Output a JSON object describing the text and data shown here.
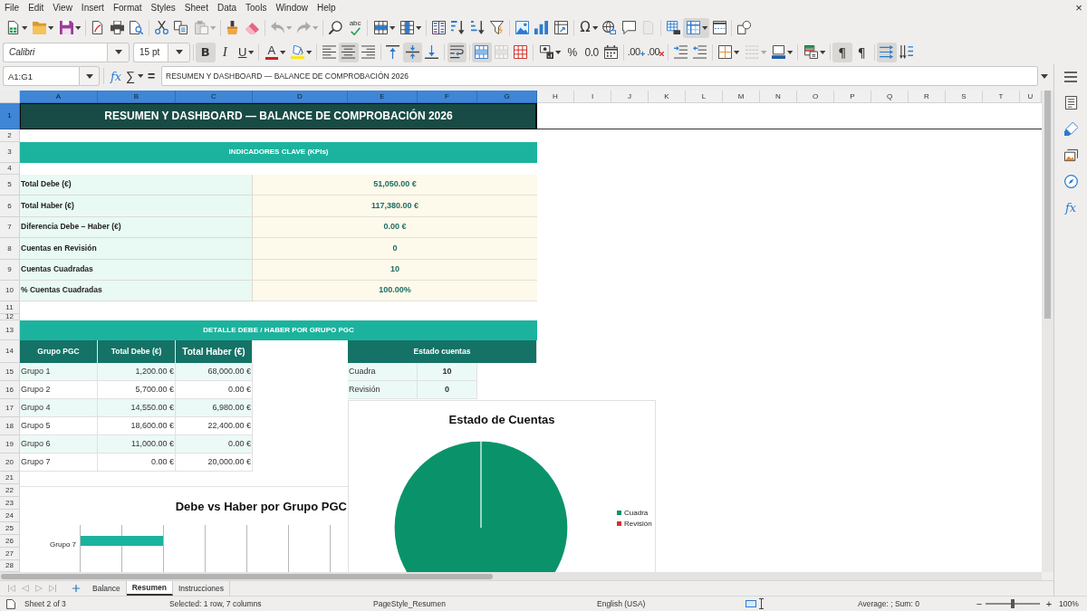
{
  "menu_bar": {
    "items": [
      "File",
      "Edit",
      "View",
      "Insert",
      "Format",
      "Styles",
      "Sheet",
      "Data",
      "Tools",
      "Window",
      "Help"
    ],
    "close": "×"
  },
  "standard_toolbar": {
    "groups": [
      [
        {
          "kind": "new",
          "pressed": false,
          "disabled": false,
          "dropdown": true
        },
        {
          "kind": "open",
          "pressed": false,
          "disabled": false,
          "dropdown": true
        },
        {
          "kind": "save",
          "pressed": false,
          "disabled": false,
          "dropdown": true
        }
      ],
      [
        {
          "kind": "export-pdf",
          "pressed": false,
          "disabled": false,
          "dropdown": false
        },
        {
          "kind": "print",
          "pressed": false,
          "disabled": false,
          "dropdown": false
        },
        {
          "kind": "print-preview",
          "pressed": false,
          "disabled": false,
          "dropdown": false
        }
      ],
      [
        {
          "kind": "cut",
          "pressed": false,
          "disabled": false,
          "dropdown": false
        },
        {
          "kind": "copy",
          "pressed": false,
          "disabled": false,
          "dropdown": false
        },
        {
          "kind": "paste",
          "pressed": false,
          "disabled": true,
          "dropdown": true
        }
      ],
      [
        {
          "kind": "clone-formatting",
          "pressed": false,
          "disabled": false,
          "dropdown": false
        },
        {
          "kind": "clear-formatting",
          "pressed": false,
          "disabled": false,
          "dropdown": false
        }
      ],
      [
        {
          "kind": "undo",
          "pressed": false,
          "disabled": true,
          "dropdown": true
        },
        {
          "kind": "redo",
          "pressed": false,
          "disabled": true,
          "dropdown": true
        }
      ],
      [
        {
          "kind": "find-replace",
          "pressed": false,
          "disabled": false,
          "dropdown": false
        },
        {
          "kind": "spelling",
          "label": "abc",
          "pressed": false,
          "disabled": false,
          "dropdown": false
        }
      ],
      [
        {
          "kind": "insert-rows",
          "pressed": false,
          "disabled": false,
          "dropdown": true
        },
        {
          "kind": "insert-columns",
          "pressed": false,
          "disabled": false,
          "dropdown": true
        }
      ],
      [
        {
          "kind": "sort",
          "pressed": false,
          "disabled": false,
          "dropdown": false
        },
        {
          "kind": "sort-ascending",
          "pressed": false,
          "disabled": false,
          "dropdown": false
        },
        {
          "kind": "sort-descending",
          "pressed": false,
          "disabled": false,
          "dropdown": false
        },
        {
          "kind": "autofilter",
          "pressed": false,
          "disabled": false,
          "dropdown": false
        }
      ],
      [
        {
          "kind": "insert-image",
          "pressed": false,
          "disabled": false,
          "dropdown": false
        },
        {
          "kind": "insert-chart",
          "pressed": false,
          "disabled": false,
          "dropdown": false
        },
        {
          "kind": "pivot-table",
          "pressed": false,
          "disabled": false,
          "dropdown": false
        }
      ],
      [
        {
          "kind": "special-character",
          "label": "Ω",
          "pressed": false,
          "disabled": false,
          "dropdown": true
        },
        {
          "kind": "hyperlink",
          "pressed": false,
          "disabled": false,
          "dropdown": false
        },
        {
          "kind": "comment",
          "pressed": false,
          "disabled": false,
          "dropdown": false
        },
        {
          "kind": "header-footer",
          "pressed": false,
          "disabled": true,
          "dropdown": false
        }
      ],
      [
        {
          "kind": "print-area",
          "pressed": false,
          "disabled": false,
          "dropdown": false
        },
        {
          "kind": "freeze",
          "pressed": true,
          "disabled": false,
          "dropdown": true
        },
        {
          "kind": "split-window",
          "pressed": false,
          "disabled": false,
          "dropdown": false
        }
      ],
      [
        {
          "kind": "draw-functions",
          "pressed": false,
          "disabled": false,
          "dropdown": false
        }
      ]
    ]
  },
  "formatting_toolbar": {
    "font_name": "Calibri",
    "font_size": "15 pt",
    "groups": [
      [
        {
          "kind": "bold",
          "label": "B",
          "pressed": true,
          "disabled": false,
          "dropdown": false
        },
        {
          "kind": "italic",
          "label": "I",
          "pressed": false,
          "disabled": false,
          "dropdown": false
        },
        {
          "kind": "underline",
          "label": "U",
          "pressed": false,
          "disabled": false,
          "dropdown": true
        }
      ],
      [
        {
          "kind": "font-color",
          "label": "A",
          "pressed": false,
          "disabled": false,
          "dropdown": true
        },
        {
          "kind": "highlight",
          "pressed": false,
          "disabled": false,
          "dropdown": true
        }
      ],
      [
        {
          "kind": "align-left",
          "pressed": false,
          "disabled": false,
          "dropdown": false
        },
        {
          "kind": "align-center",
          "pressed": true,
          "disabled": false,
          "dropdown": false
        },
        {
          "kind": "align-right",
          "pressed": false,
          "disabled": false,
          "dropdown": false
        }
      ],
      [
        {
          "kind": "align-top",
          "pressed": false,
          "disabled": false,
          "dropdown": false
        },
        {
          "kind": "align-middle",
          "pressed": true,
          "disabled": false,
          "dropdown": false
        },
        {
          "kind": "align-bottom",
          "pressed": false,
          "disabled": false,
          "dropdown": false
        }
      ],
      [
        {
          "kind": "wrap-text",
          "pressed": true,
          "disabled": false,
          "dropdown": false
        }
      ],
      [
        {
          "kind": "merge-center",
          "pressed": true,
          "disabled": false,
          "dropdown": false
        },
        {
          "kind": "merge-cells",
          "pressed": false,
          "disabled": true,
          "dropdown": false
        },
        {
          "kind": "unmerge-cells",
          "pressed": false,
          "disabled": false,
          "dropdown": false
        }
      ],
      [
        {
          "kind": "currency",
          "pressed": false,
          "disabled": false,
          "dropdown": true
        },
        {
          "kind": "percent",
          "label": "%",
          "pressed": false,
          "disabled": false,
          "dropdown": false
        },
        {
          "kind": "number",
          "label": "0.0",
          "pressed": false,
          "disabled": false,
          "dropdown": false
        },
        {
          "kind": "date",
          "pressed": false,
          "disabled": false,
          "dropdown": false
        }
      ],
      [
        {
          "kind": "add-decimal",
          "label": ".00",
          "pressed": false,
          "disabled": false,
          "dropdown": false
        },
        {
          "kind": "delete-decimal",
          "label": ".00",
          "pressed": false,
          "disabled": false,
          "dropdown": false
        }
      ],
      [
        {
          "kind": "indent-increase",
          "pressed": false,
          "disabled": false,
          "dropdown": false
        },
        {
          "kind": "indent-decrease",
          "pressed": false,
          "disabled": false,
          "dropdown": false
        }
      ],
      [
        {
          "kind": "borders",
          "pressed": false,
          "disabled": false,
          "dropdown": true
        },
        {
          "kind": "border-style",
          "pressed": false,
          "disabled": true,
          "dropdown": true
        },
        {
          "kind": "border-color",
          "pressed": false,
          "disabled": false,
          "dropdown": true
        }
      ],
      [
        {
          "kind": "conditional",
          "pressed": false,
          "disabled": false,
          "dropdown": true
        }
      ],
      [
        {
          "kind": "paragraph-ltr",
          "label": "¶",
          "pressed": true,
          "disabled": false,
          "dropdown": false
        },
        {
          "kind": "paragraph-rtl",
          "label": "¶",
          "pressed": false,
          "disabled": false,
          "dropdown": false
        }
      ],
      [
        {
          "kind": "text-ltr",
          "pressed": true,
          "disabled": false,
          "dropdown": false
        },
        {
          "kind": "text-ttb",
          "pressed": false,
          "disabled": false,
          "dropdown": false
        }
      ]
    ]
  },
  "formula_bar": {
    "name_box": "A1:G1",
    "function_wizard": "fx",
    "sum": "∑",
    "equals": "=",
    "content": "RESUMEN Y DASHBOARD — BALANCE DE COMPROBACIÓN 2026"
  },
  "sidebar": {
    "tabs": [
      {
        "kind": "properties"
      },
      {
        "kind": "styles"
      },
      {
        "kind": "gallery"
      },
      {
        "kind": "navigator"
      },
      {
        "kind": "functions",
        "label": "fx"
      }
    ]
  },
  "sheet": {
    "column_headers": [
      {
        "label": "A",
        "selected": true
      },
      {
        "label": "B",
        "selected": true
      },
      {
        "label": "C",
        "selected": true
      },
      {
        "label": "D",
        "selected": true
      },
      {
        "label": "E",
        "selected": true
      },
      {
        "label": "F",
        "selected": true
      },
      {
        "label": "G",
        "selected": true
      },
      {
        "label": "H",
        "selected": false
      },
      {
        "label": "I",
        "selected": false
      },
      {
        "label": "J",
        "selected": false
      },
      {
        "label": "K",
        "selected": false
      },
      {
        "label": "L",
        "selected": false
      },
      {
        "label": "M",
        "selected": false
      },
      {
        "label": "N",
        "selected": false
      },
      {
        "label": "O",
        "selected": false
      },
      {
        "label": "P",
        "selected": false
      },
      {
        "label": "Q",
        "selected": false
      },
      {
        "label": "R",
        "selected": false
      },
      {
        "label": "S",
        "selected": false
      },
      {
        "label": "T",
        "selected": false
      },
      {
        "label": "U",
        "selected": false
      }
    ],
    "row_headers": [
      {
        "label": "1",
        "selected": true
      },
      {
        "label": "2",
        "selected": false
      },
      {
        "label": "3",
        "selected": false
      },
      {
        "label": "4",
        "selected": false
      },
      {
        "label": "5",
        "selected": false
      },
      {
        "label": "6",
        "selected": false
      },
      {
        "label": "7",
        "selected": false
      },
      {
        "label": "8",
        "selected": false
      },
      {
        "label": "9",
        "selected": false
      },
      {
        "label": "10",
        "selected": false
      },
      {
        "label": "11",
        "selected": false
      },
      {
        "label": "12",
        "selected": false
      },
      {
        "label": "13",
        "selected": false
      },
      {
        "label": "14",
        "selected": false
      },
      {
        "label": "15",
        "selected": false
      },
      {
        "label": "16",
        "selected": false
      },
      {
        "label": "17",
        "selected": false
      },
      {
        "label": "18",
        "selected": false
      },
      {
        "label": "19",
        "selected": false
      },
      {
        "label": "20",
        "selected": false
      },
      {
        "label": "21",
        "selected": false
      },
      {
        "label": "22",
        "selected": false
      },
      {
        "label": "23",
        "selected": false
      },
      {
        "label": "24",
        "selected": false
      },
      {
        "label": "25",
        "selected": false
      },
      {
        "label": "26",
        "selected": false
      },
      {
        "label": "27",
        "selected": false
      },
      {
        "label": "28",
        "selected": false
      }
    ],
    "title_cell": {
      "text": "RESUMEN Y DASHBOARD — BALANCE DE COMPROBACIÓN 2026",
      "selected": true
    },
    "kpi_section": {
      "heading": "INDICADORES CLAVE (KPIs)",
      "rows": [
        {
          "label": "Total Debe (€)",
          "value": "51,050.00 €"
        },
        {
          "label": "Total Haber (€)",
          "value": "117,380.00 €"
        },
        {
          "label": "Diferencia Debe – Haber (€)",
          "value": "0.00 €"
        },
        {
          "label": "Cuentas en Revisión",
          "value": "0"
        },
        {
          "label": "Cuentas Cuadradas",
          "value": "10"
        },
        {
          "label": "% Cuentas Cuadradas",
          "value": "100.00%"
        }
      ]
    },
    "detail_section": {
      "heading": "DETALLE DEBE / HABER POR GRUPO PGC",
      "columns": [
        "Grupo PGC",
        "Total Debe (€)",
        "Total Haber (€)"
      ],
      "rows": [
        [
          "Grupo 1",
          "1,200.00 €",
          "68,000.00 €"
        ],
        [
          "Grupo 2",
          "5,700.00 €",
          "0.00 €"
        ],
        [
          "Grupo 4",
          "14,550.00 €",
          "6,980.00 €"
        ],
        [
          "Grupo 5",
          "18,600.00 €",
          "22,400.00 €"
        ],
        [
          "Grupo 6",
          "11,000.00 €",
          "0.00 €"
        ],
        [
          "Grupo 7",
          "0.00 €",
          "20,000.00 €"
        ]
      ]
    },
    "status_table": {
      "heading": "Estado cuentas",
      "rows": [
        {
          "label": "Cuadra",
          "value": "10"
        },
        {
          "label": "Revisión",
          "value": "0"
        }
      ]
    },
    "bar_chart": {
      "title": "Debe vs Haber por Grupo PGC",
      "category_labels": [
        "Grupo 7"
      ]
    },
    "pie_chart": {
      "chart_data": {
        "type": "pie",
        "title": "Estado de Cuentas",
        "categories": [
          "Cuadra",
          "Revisión"
        ],
        "values": [
          100,
          0
        ],
        "colors": [
          "#0a936a",
          "#d6312d"
        ]
      }
    }
  },
  "sheet_tabs": {
    "navigation": [
      {
        "kind": "first",
        "disabled": true
      },
      {
        "kind": "previous",
        "disabled": true
      },
      {
        "kind": "next",
        "disabled": true
      },
      {
        "kind": "last",
        "disabled": true
      }
    ],
    "tabs": [
      {
        "label": "Balance",
        "selected": false
      },
      {
        "label": "Resumen",
        "selected": true
      },
      {
        "label": "Instrucciones",
        "selected": false
      }
    ]
  },
  "status_bar": {
    "sheet_position": "Sheet 2 of 3",
    "selection": "Selected: 1 row, 7 columns",
    "page_style": "PageStyle_Resumen",
    "language": "English (USA)",
    "summary": "Average: ; Sum: 0",
    "zoom": {
      "zoom_out": "−",
      "level": 0.5,
      "zoom_in": "+",
      "reading": "100%"
    }
  }
}
